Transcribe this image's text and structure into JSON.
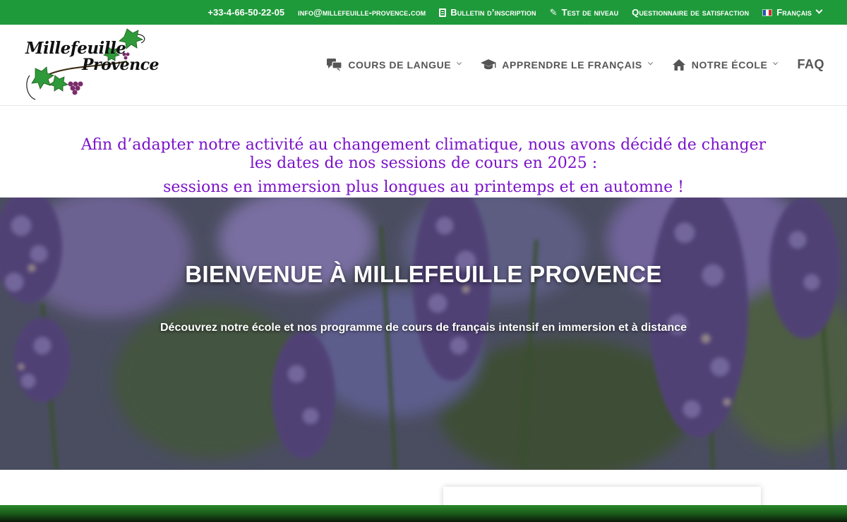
{
  "topbar": {
    "phone": "+33-4-66-50-22-05",
    "email": "info@millefeuille-provence.com",
    "bulletin": "Bulletin d’inscription",
    "test": "Test de niveau",
    "questionnaire": "Questionnaire de satisfaction",
    "language": "Français",
    "color": "#1f9a3b"
  },
  "logo": {
    "line1": "Millefeuille",
    "line2": "Provence"
  },
  "nav": {
    "items": [
      {
        "label": "Cours de langue",
        "icon": "chat-bubbles-icon"
      },
      {
        "label": "Apprendre le français",
        "icon": "graduation-cap-icon"
      },
      {
        "label": "Notre école",
        "icon": "home-icon"
      }
    ],
    "faq": "FAQ"
  },
  "announcement": {
    "line1": "Afin d’adapter notre activité au changement climatique, nous avons décidé de changer les dates de nos sessions de cours en 2025 :",
    "line2": "sessions en immersion plus longues au printemps et en automne !",
    "color": "#7b13c9"
  },
  "hero": {
    "title": "BIENVENUE À MILLEFEUILLE PROVENCE",
    "subtitle": "Découvrez notre école et nos programme de cours de français intensif en immersion et à distance"
  }
}
